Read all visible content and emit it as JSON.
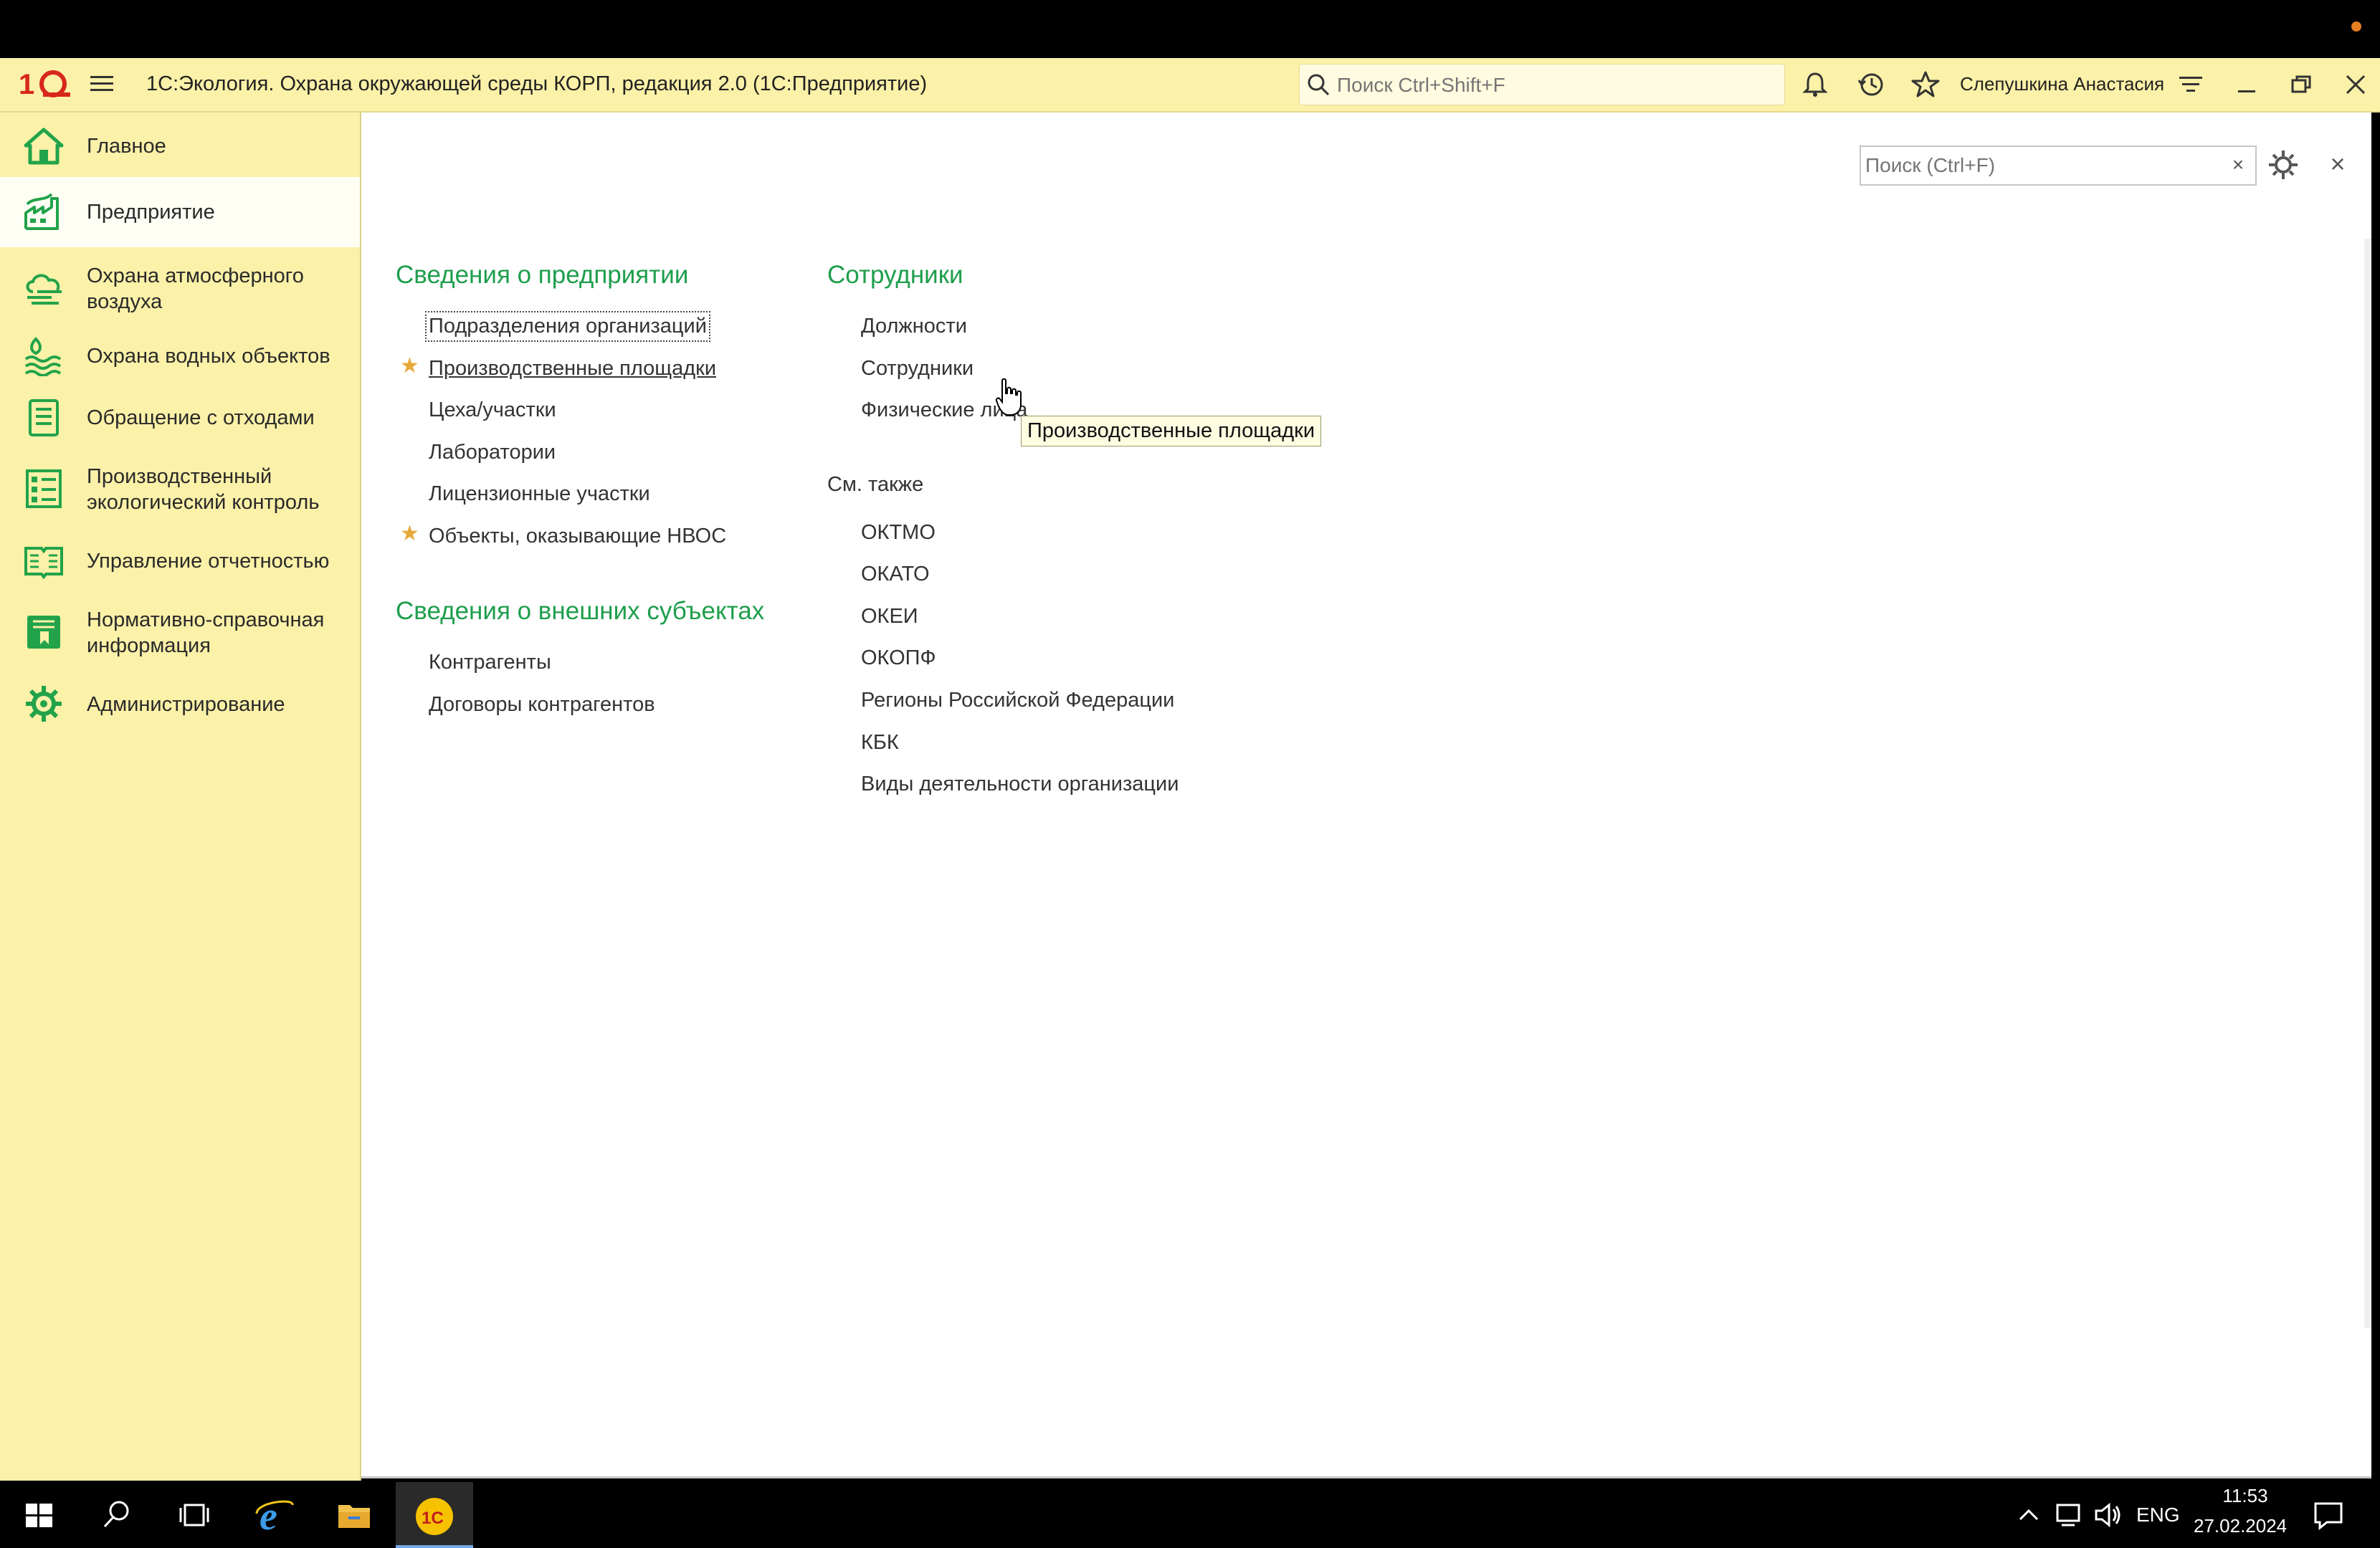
{
  "window": {
    "title": "1С:Экология. Охрана окружающей среды КОРП, редакция 2.0  (1С:Предприятие)",
    "search_placeholder": "Поиск Ctrl+Shift+F",
    "user": "Слепушкина Анастасия"
  },
  "sidebar": {
    "items": [
      {
        "label": "Главное",
        "icon": "home-icon"
      },
      {
        "label": "Предприятие",
        "icon": "factory-icon",
        "active": true
      },
      {
        "label": "Охрана атмосферного воздуха",
        "icon": "cloud-icon"
      },
      {
        "label": "Охрана водных объектов",
        "icon": "water-icon"
      },
      {
        "label": "Обращение с отходами",
        "icon": "waste-icon"
      },
      {
        "label": "Производственный экологический контроль",
        "icon": "checklist-icon"
      },
      {
        "label": "Управление отчетностью",
        "icon": "book-icon"
      },
      {
        "label": "Нормативно-справочная информация",
        "icon": "reference-book-icon"
      },
      {
        "label": "Администрирование",
        "icon": "gear-icon"
      }
    ]
  },
  "form": {
    "search_placeholder": "Поиск (Ctrl+F)",
    "clear": "×",
    "close": "×"
  },
  "sections": {
    "enterprise": {
      "title": "Сведения о предприятии",
      "links": [
        "Подразделения организаций",
        "Производственные площадки",
        "Цеха/участки",
        "Лаборатории",
        "Лицензионные участки",
        "Объекты, оказывающие НВОС"
      ]
    },
    "external": {
      "title": "Сведения о внешних субъектах",
      "links": [
        "Контрагенты",
        "Договоры контрагентов"
      ]
    },
    "employees": {
      "title": "Сотрудники",
      "links": [
        "Должности",
        "Сотрудники",
        "Физические лица"
      ]
    },
    "see_also": {
      "title": "См. также",
      "links": [
        "ОКТМО",
        "ОКАТО",
        "ОКЕИ",
        "ОКОПФ",
        "Регионы Российской Федерации",
        "КБК",
        "Виды деятельности организации"
      ]
    }
  },
  "tooltip": "Производственные площадки",
  "taskbar": {
    "lang": "ENG",
    "time": "11:53",
    "date": "27.02.2024"
  },
  "colors": {
    "panel_yellow": "#fbf1a8",
    "section_green": "#1e9e4c",
    "star": "#e8a93a"
  }
}
